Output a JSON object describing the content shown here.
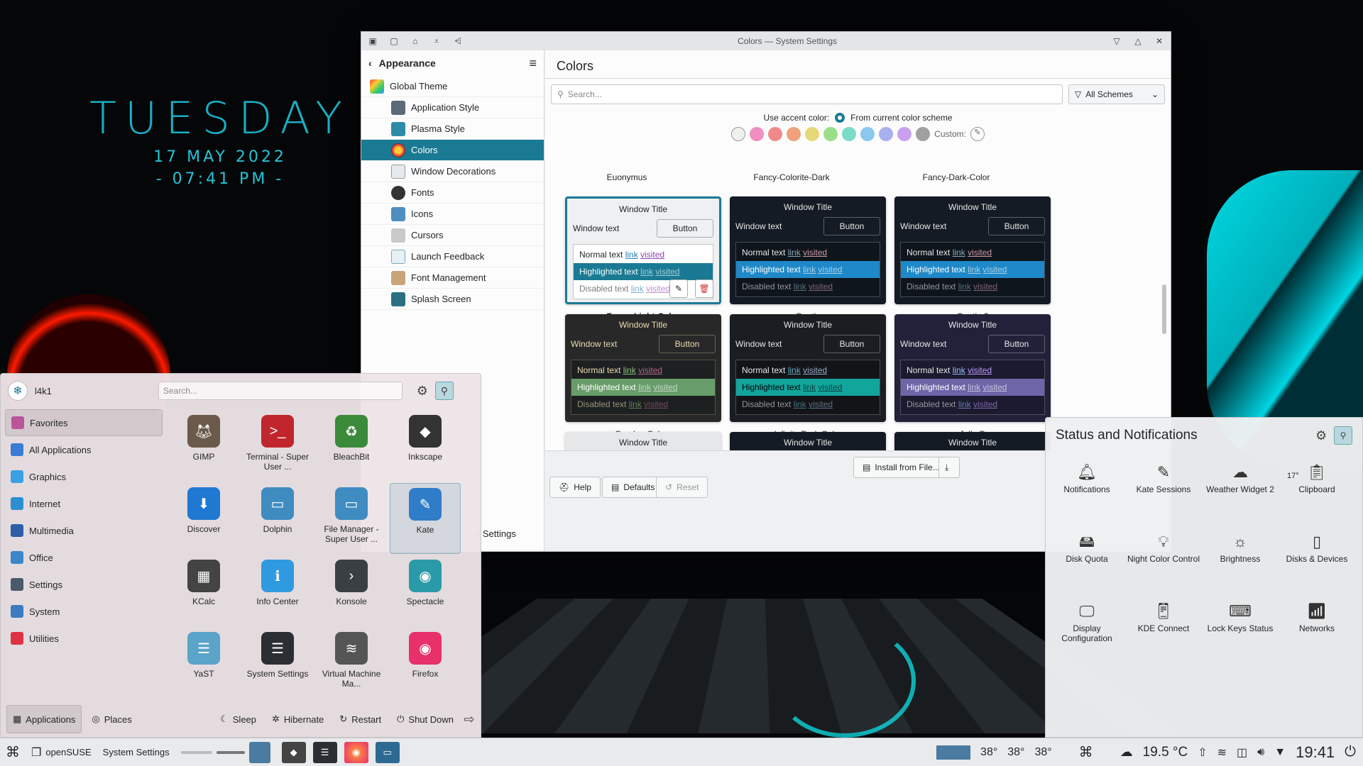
{
  "desktop": {
    "day": "TUESDAY",
    "date": "17 MAY 2022",
    "time": "- 07:41 PM -"
  },
  "settings": {
    "title": "Colors — System Settings",
    "sidebar_title": "Appearance",
    "global_theme": "Global Theme",
    "items": [
      "Application Style",
      "Plasma Style",
      "Colors",
      "Window Decorations",
      "Fonts",
      "Icons",
      "Cursors",
      "Launch Feedback",
      "Font Management",
      "Splash Screen"
    ],
    "page_title": "Colors",
    "search_placeholder": "Search...",
    "filter": "All Schemes",
    "accent_label": "Use accent color:",
    "accent_option": "From current color scheme",
    "custom_label": "Custom:",
    "accent_colors": [
      "#f0f0f0",
      "#f08fc0",
      "#f08a8a",
      "#f0a07a",
      "#e6d77a",
      "#9ade8a",
      "#7adcc8",
      "#8ac8ee",
      "#a8b0ee",
      "#c8a0ee",
      "#a0a0a0"
    ],
    "column_headers": [
      "Euonymus",
      "Fancy-Colorite-Dark",
      "Fancy-Dark-Color"
    ],
    "preview": {
      "window_title": "Window Title",
      "window_text": "Window text",
      "button": "Button",
      "normal": "Normal text",
      "highlighted": "Highlighted text",
      "disabled": "Disabled text",
      "link": "link",
      "visited": "visited"
    },
    "schemes": [
      "Fancy-Light-Color",
      "Gently",
      "Gently-3",
      "GruvboxColors",
      "Infinity Dark Color",
      "Jolly-D"
    ],
    "install_button": "Install from File...",
    "help_button": "Help",
    "defaults_button": "Defaults",
    "reset_button": "Reset",
    "hidden_label": "d Settings"
  },
  "launcher": {
    "user": "l4k1",
    "search_placeholder": "Search...",
    "categories": [
      "Favorites",
      "All Applications",
      "Graphics",
      "Internet",
      "Multimedia",
      "Office",
      "Settings",
      "System",
      "Utilities"
    ],
    "apps": [
      "GIMP",
      "Terminal - Super User ...",
      "BleachBit",
      "Inkscape",
      "Discover",
      "Dolphin",
      "File Manager - Super User ...",
      "Kate",
      "KCalc",
      "Info Center",
      "Konsole",
      "Spectacle",
      "YaST",
      "System Settings",
      "Virtual Machine Ma...",
      "Firefox"
    ],
    "footer": [
      "Applications",
      "Places",
      "Sleep",
      "Hibernate",
      "Restart",
      "Shut Down"
    ]
  },
  "status": {
    "title": "Status and Notifications",
    "items": [
      "Notifications",
      "Kate Sessions",
      "Weather Widget 2",
      "Clipboard",
      "Disk Quota",
      "Night Color Control",
      "Brightness",
      "Disks & Devices",
      "Display Configuration",
      "KDE Connect",
      "Lock Keys Status",
      "Networks"
    ],
    "weather_temp": "17°"
  },
  "taskbar": {
    "tasks": [
      "openSUSE",
      "System Settings"
    ],
    "temps": [
      "38°",
      "38°",
      "38°"
    ],
    "weather": "19.5 °C",
    "clock": "19:41"
  }
}
